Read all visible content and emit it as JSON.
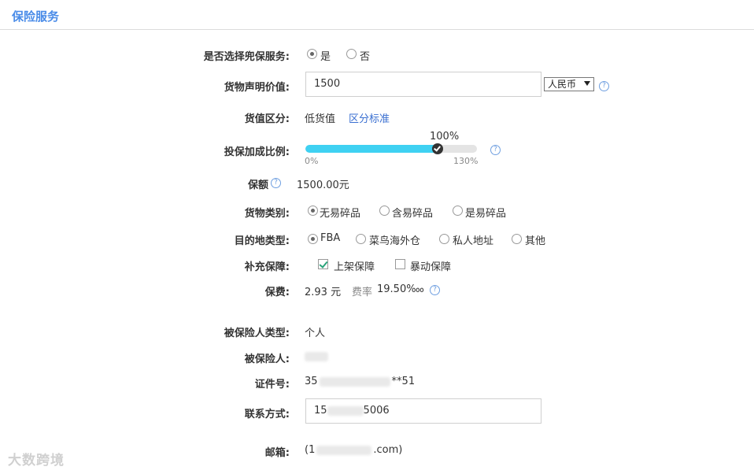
{
  "header": {
    "title": "保险服务"
  },
  "form": {
    "choose_service": {
      "label": "是否选择兜保服务:",
      "options": [
        "是",
        "否"
      ],
      "selected": "是"
    },
    "declared_value": {
      "label": "货物声明价值:",
      "value": "1500",
      "currency": "人民币"
    },
    "value_class": {
      "label": "货值区分:",
      "value": "低货值",
      "link": "区分标准"
    },
    "ratio": {
      "label": "投保加成比例:",
      "current": "100%",
      "min": "0%",
      "max": "130%",
      "fraction": 0.769
    },
    "amount": {
      "label": "保额",
      "value": "1500.00元"
    },
    "cargo_type": {
      "label": "货物类别:",
      "options": [
        "无易碎品",
        "含易碎品",
        "是易碎品"
      ],
      "selected": "无易碎品"
    },
    "destination": {
      "label": "目的地类型:",
      "options": [
        "FBA",
        "菜鸟海外仓",
        "私人地址",
        "其他"
      ],
      "selected": "FBA"
    },
    "extra": {
      "label": "补充保障:",
      "options": [
        {
          "text": "上架保障",
          "checked": true
        },
        {
          "text": "暴动保障",
          "checked": false
        }
      ]
    },
    "fee": {
      "label": "保费:",
      "value": "2.93 元",
      "rate_label": "费率",
      "rate": "19.50‱"
    },
    "insured_type": {
      "label": "被保险人类型:",
      "value": "个人"
    },
    "insured": {
      "label": "被保险人:"
    },
    "id_number": {
      "label": "证件号:",
      "prefix": "35",
      "suffix": "**51"
    },
    "contact": {
      "label": "联系方式:",
      "prefix": "15",
      "suffix": "5006"
    },
    "email": {
      "label": "邮箱:",
      "prefix": "(1",
      "suffix": ".com)"
    }
  },
  "watermark": "大数跨境",
  "help_glyph": "?"
}
